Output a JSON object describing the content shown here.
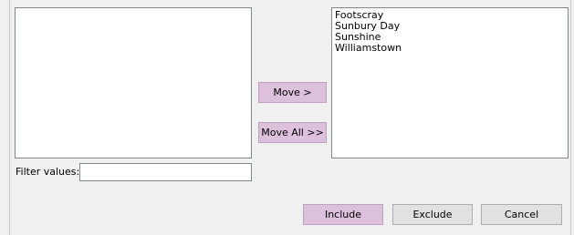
{
  "available_list": {
    "items": []
  },
  "selected_list": {
    "items": [
      "Footscray",
      "Sunbury Day",
      "Sunshine",
      "Williamstown"
    ]
  },
  "buttons": {
    "move": "Move >",
    "move_all": "Move All >>",
    "include": "Include",
    "exclude": "Exclude",
    "cancel": "Cancel"
  },
  "filter": {
    "label": "Filter values:",
    "value": ""
  },
  "colors": {
    "accent_button": "#dcc0dc",
    "background": "#f0f0f0"
  }
}
